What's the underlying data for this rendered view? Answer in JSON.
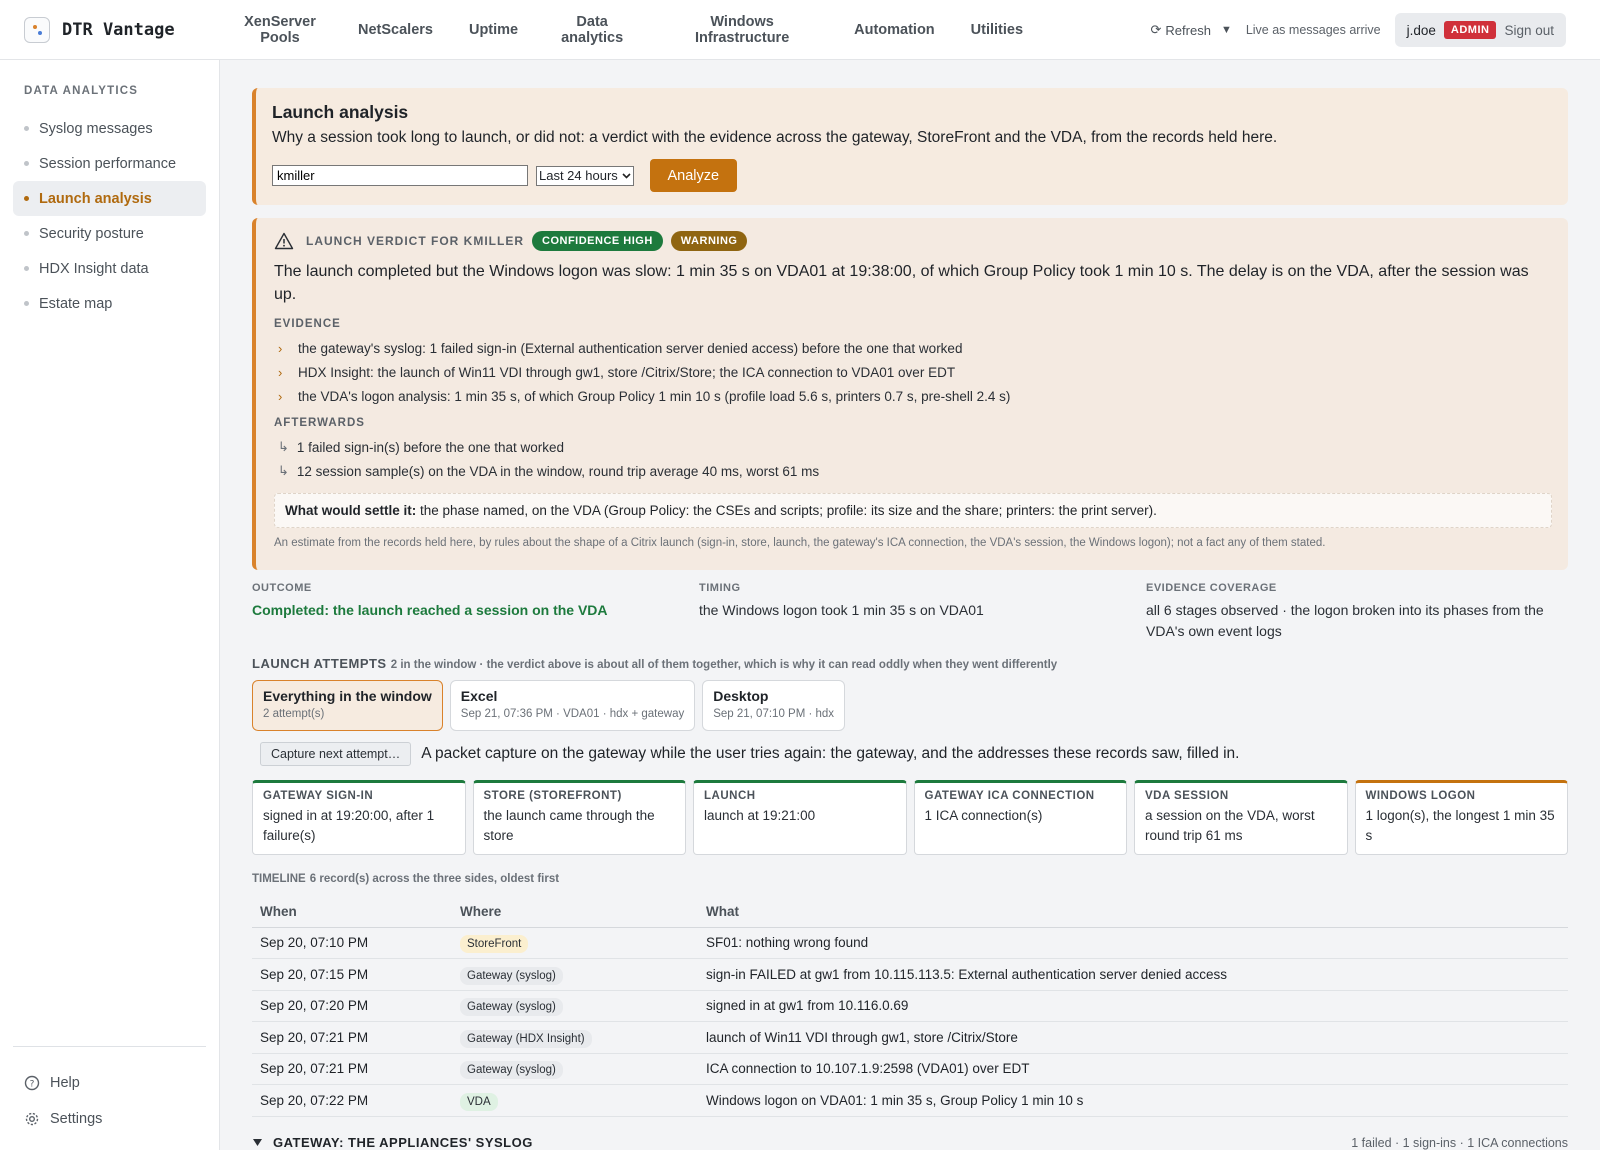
{
  "brand": {
    "name": "DTR Vantage"
  },
  "nav": [
    "XenServer Pools",
    "NetScalers",
    "Uptime",
    "Data analytics",
    "Windows Infrastructure",
    "Automation",
    "Utilities"
  ],
  "header": {
    "refresh": "Refresh",
    "live": "Live as messages arrive",
    "user": "j.doe",
    "role": "ADMIN",
    "signout": "Sign out"
  },
  "sidebar": {
    "title": "DATA ANALYTICS",
    "items": [
      "Syslog messages",
      "Session performance",
      "Launch analysis",
      "Security posture",
      "HDX Insight data",
      "Estate map"
    ],
    "active": "Launch analysis",
    "help": "Help",
    "settings": "Settings"
  },
  "launch": {
    "title": "Launch analysis",
    "desc": "Why a session took long to launch, or did not: a verdict with the evidence across the gateway, StoreFront and the VDA, from the records held here.",
    "user_value": "kmiller",
    "range": "Last 24 hours",
    "analyze": "Analyze"
  },
  "verdict": {
    "label": "LAUNCH VERDICT FOR KMILLER",
    "confidence": "CONFIDENCE HIGH",
    "severity": "WARNING",
    "text": "The launch completed but the Windows logon was slow: 1 min 35 s on VDA01 at 19:38:00, of which Group Policy took 1 min 10 s. The delay is on the VDA, after the session was up.",
    "evidence_title": "EVIDENCE",
    "evidence": [
      "the gateway's syslog: 1 failed sign-in (External authentication server denied access) before the one that worked",
      "HDX Insight: the launch of Win11 VDI through gw1, store /Citrix/Store; the ICA connection to VDA01 over EDT",
      "the VDA's logon analysis: 1 min 35 s, of which Group Policy 1 min 10 s (profile load 5.6 s, printers 0.7 s, pre-shell 2.4 s)"
    ],
    "afterwards_title": "AFTERWARDS",
    "afterwards": [
      "1 failed sign-in(s) before the one that worked",
      "12 session sample(s) on the VDA in the window, round trip average 40 ms, worst 61 ms"
    ],
    "settle_label": "What would settle it:",
    "settle_text": "the phase named, on the VDA (Group Policy: the CSEs and scripts; profile: its size and the share; printers: the print server).",
    "estimate": "An estimate from the records held here, by rules about the shape of a Citrix launch (sign-in, store, launch, the gateway's ICA connection, the VDA's session, the Windows logon); not a fact any of them stated."
  },
  "facts": [
    {
      "label": "OUTCOME",
      "value": "Completed: the launch reached a session on the VDA"
    },
    {
      "label": "TIMING",
      "value": "the Windows logon took 1 min 35 s on VDA01"
    },
    {
      "label": "EVIDENCE COVERAGE",
      "value": "all 6 stages observed · the logon broken into its phases from the VDA's own event logs"
    }
  ],
  "attempts": {
    "title": "LAUNCH ATTEMPTS",
    "subtitle": "2 in the window · the verdict above is about all of them together, which is why it can read oddly when they went differently",
    "tabs": [
      {
        "title": "Everything in the window",
        "sub": "2 attempt(s)"
      },
      {
        "title": "Excel",
        "sub": "Sep 21, 07:36 PM · VDA01 · hdx + gateway"
      },
      {
        "title": "Desktop",
        "sub": "Sep 21, 07:10 PM · hdx"
      }
    ]
  },
  "capture": {
    "button": "Capture next attempt…",
    "text": "A packet capture on the gateway while the user tries again: the gateway, and the addresses these records saw, filled in."
  },
  "stages": [
    {
      "label": "GATEWAY SIGN-IN",
      "value": "signed in at 19:20:00, after 1 failure(s)"
    },
    {
      "label": "STORE (STOREFRONT)",
      "value": "the launch came through the store"
    },
    {
      "label": "LAUNCH",
      "value": "launch at 19:21:00"
    },
    {
      "label": "GATEWAY ICA CONNECTION",
      "value": "1 ICA connection(s)"
    },
    {
      "label": "VDA SESSION",
      "value": "a session on the VDA, worst round trip 61 ms"
    },
    {
      "label": "WINDOWS LOGON",
      "value": "1 logon(s), the longest 1 min 35 s"
    }
  ],
  "timeline": {
    "title": "TIMELINE",
    "subtitle": "6 record(s) across the three sides, oldest first",
    "headers": [
      "When",
      "Where",
      "What"
    ],
    "rows": [
      {
        "when": "Sep 20, 07:10 PM",
        "where": "StoreFront",
        "what": "SF01: nothing wrong found"
      },
      {
        "when": "Sep 20, 07:15 PM",
        "where": "Gateway (syslog)",
        "what": "sign-in FAILED at gw1 from 10.115.113.5: External authentication server denied access"
      },
      {
        "when": "Sep 20, 07:20 PM",
        "where": "Gateway (syslog)",
        "what": "signed in at gw1 from 10.116.0.69"
      },
      {
        "when": "Sep 20, 07:21 PM",
        "where": "Gateway (HDX Insight)",
        "what": "launch of Win11 VDI through gw1, store /Citrix/Store"
      },
      {
        "when": "Sep 20, 07:21 PM",
        "where": "Gateway (syslog)",
        "what": "ICA connection to 10.107.1.9:2598 (VDA01) over EDT"
      },
      {
        "when": "Sep 20, 07:22 PM",
        "where": "VDA",
        "what": "Windows logon on VDA01: 1 min 35 s, Group Policy 1 min 10 s"
      }
    ]
  },
  "gateway_section": {
    "title": "GATEWAY: THE APPLIANCES' SYSLOG",
    "summary": "1 failed · 1 sign-ins · 1 ICA connections"
  }
}
